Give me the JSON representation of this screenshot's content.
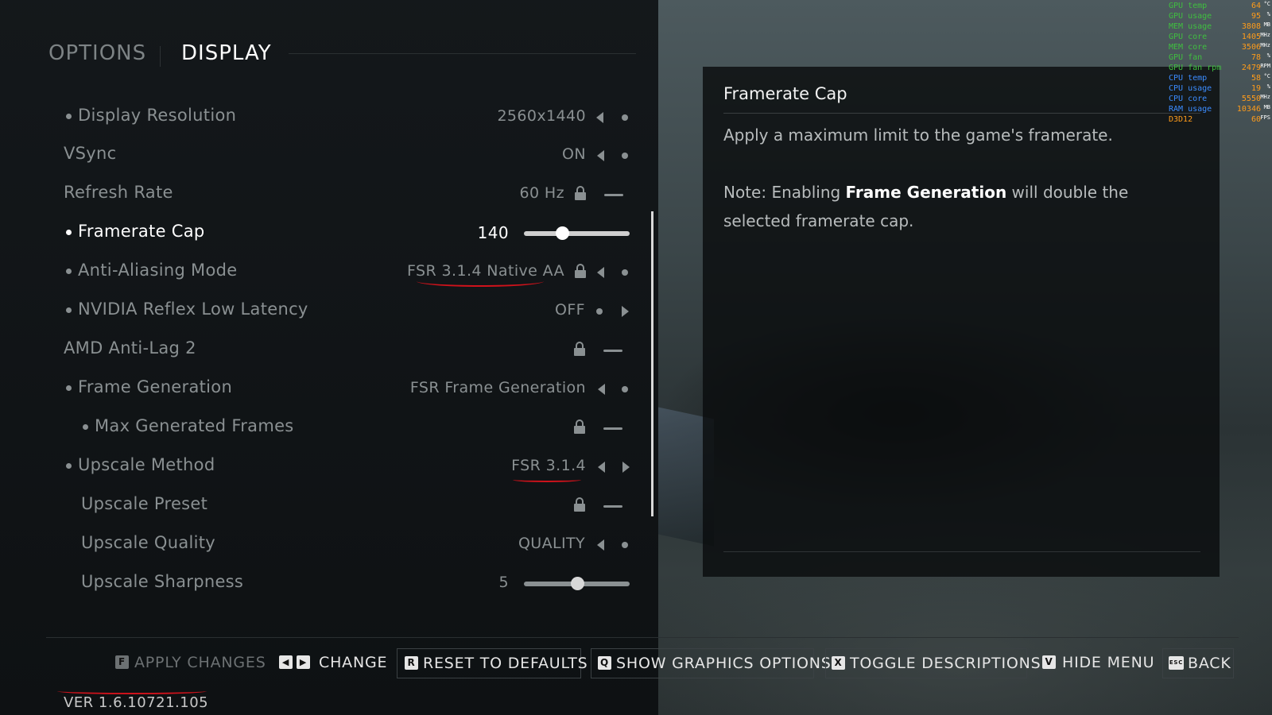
{
  "tabs": {
    "options": "OPTIONS",
    "display": "DISPLAY"
  },
  "settings": [
    {
      "label": "Display Resolution",
      "value": "2560x1440",
      "bullet": true
    },
    {
      "label": "VSync",
      "value": "ON",
      "bullet": false
    },
    {
      "label": "Refresh Rate",
      "value": "60 Hz",
      "bullet": false
    },
    {
      "label": "Framerate Cap",
      "value": "140",
      "bullet": true,
      "slider_fraction": 0.36
    },
    {
      "label": "Anti-Aliasing Mode",
      "value": "FSR 3.1.4 Native AA",
      "bullet": true
    },
    {
      "label": "NVIDIA Reflex Low Latency",
      "value": "OFF",
      "bullet": true
    },
    {
      "label": "AMD Anti-Lag 2",
      "value": "",
      "bullet": false
    },
    {
      "label": "Frame Generation",
      "value": "FSR Frame Generation",
      "bullet": true
    },
    {
      "label": "Max Generated Frames",
      "value": "",
      "bullet": true
    },
    {
      "label": "Upscale Method",
      "value": "FSR 3.1.4",
      "bullet": true
    },
    {
      "label": "Upscale Preset",
      "value": "",
      "bullet": false
    },
    {
      "label": "Upscale Quality",
      "value": "QUALITY",
      "bullet": false
    },
    {
      "label": "Upscale Sharpness",
      "value": "5",
      "bullet": false,
      "slider_fraction": 0.5
    }
  ],
  "description": {
    "title": "Framerate Cap",
    "line1": "Apply a maximum limit to the game's framerate.",
    "note_prefix": "Note: Enabling ",
    "note_bold": "Frame Generation",
    "note_suffix": " will double the selected framerate cap."
  },
  "osd": [
    {
      "label": "GPU temp",
      "value": "64",
      "unit": "°C",
      "color": "#3fbf3f"
    },
    {
      "label": "GPU usage",
      "value": "95",
      "unit": "%",
      "color": "#3fbf3f"
    },
    {
      "label": "MEM usage",
      "value": "3808",
      "unit": "MB",
      "color": "#3fbf3f"
    },
    {
      "label": "GPU core",
      "value": "1405",
      "unit": "MHz",
      "color": "#3fbf3f"
    },
    {
      "label": "MEM core",
      "value": "3506",
      "unit": "MHz",
      "color": "#3fbf3f"
    },
    {
      "label": "GPU fan",
      "value": "78",
      "unit": "%",
      "color": "#3fbf3f"
    },
    {
      "label": "GPU fan rpm",
      "value": "2479",
      "unit": "RPM",
      "color": "#3fbf3f"
    },
    {
      "label": "CPU temp",
      "value": "58",
      "unit": "°C",
      "color": "#3b8cff"
    },
    {
      "label": "CPU usage",
      "value": "19",
      "unit": "%",
      "color": "#3b8cff"
    },
    {
      "label": "CPU core",
      "value": "5550",
      "unit": "MHz",
      "color": "#3b8cff"
    },
    {
      "label": "RAM usage",
      "value": "10346",
      "unit": "MB",
      "color": "#3b8cff"
    },
    {
      "label": "D3D12",
      "value": "60",
      "unit": "FPS",
      "color": "#ff9c1a"
    }
  ],
  "footer": {
    "apply": {
      "key": "F",
      "label": "APPLY CHANGES"
    },
    "change": {
      "label": "CHANGE"
    },
    "reset": {
      "key": "R",
      "label": "RESET TO DEFAULTS"
    },
    "graphics": {
      "key": "Q",
      "label": "SHOW GRAPHICS OPTIONS"
    },
    "toggle": {
      "key": "X",
      "label": "TOGGLE DESCRIPTIONS"
    },
    "hide": {
      "key": "V",
      "label": "HIDE MENU"
    },
    "back": {
      "key": "ESC",
      "label": "BACK"
    }
  },
  "version": "VER 1.6.10721.105",
  "colors": {
    "annotation_red": "#d0121b",
    "osd_value": "#ff9c1a"
  }
}
